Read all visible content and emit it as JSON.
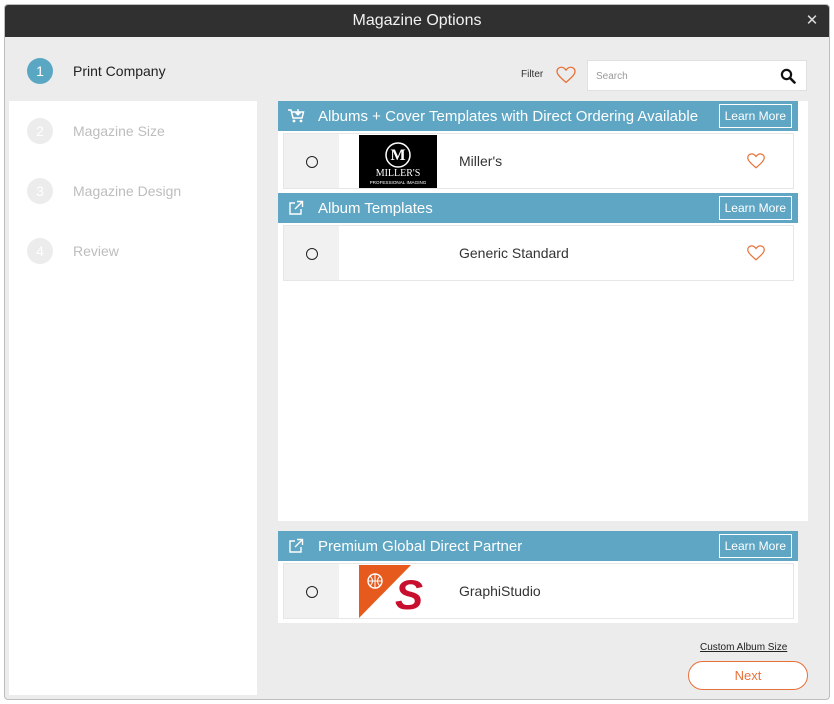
{
  "window": {
    "title": "Magazine Options",
    "close_glyph": "✕"
  },
  "steps": [
    {
      "number": "1",
      "label": "Print Company",
      "active": true
    },
    {
      "number": "2",
      "label": "Magazine Size",
      "active": false
    },
    {
      "number": "3",
      "label": "Magazine Design",
      "active": false
    },
    {
      "number": "4",
      "label": "Review",
      "active": false
    }
  ],
  "toolbar": {
    "filter_label": "Filter",
    "filter_icon": "heart-outline-icon",
    "search_placeholder": "Search",
    "search_icon": "magnifier-icon"
  },
  "sections": [
    {
      "title": "Albums + Cover Templates with Direct Ordering Available",
      "icon": "cart-icon",
      "learn_more": "Learn More",
      "rows": [
        {
          "name": "Miller's",
          "logo": "millers-logo",
          "logo_text_big": "MILLER'S",
          "logo_text_small": "PROFESSIONAL IMAGING"
        }
      ]
    },
    {
      "title": "Album Templates",
      "icon": "external-link-icon",
      "learn_more": "Learn More",
      "rows": [
        {
          "name": "Generic Standard",
          "logo": ""
        }
      ]
    },
    {
      "title": "Premium Global Direct Partner",
      "icon": "external-link-icon",
      "learn_more": "Learn More",
      "rows": [
        {
          "name": "GraphiStudio",
          "logo": "graphistudio-logo"
        }
      ]
    }
  ],
  "footer": {
    "custom_size": "Custom Album Size",
    "next": "Next"
  },
  "colors": {
    "accent_blue": "#5ea6c3",
    "accent_orange": "#e8713a",
    "titlebar": "#303030"
  }
}
